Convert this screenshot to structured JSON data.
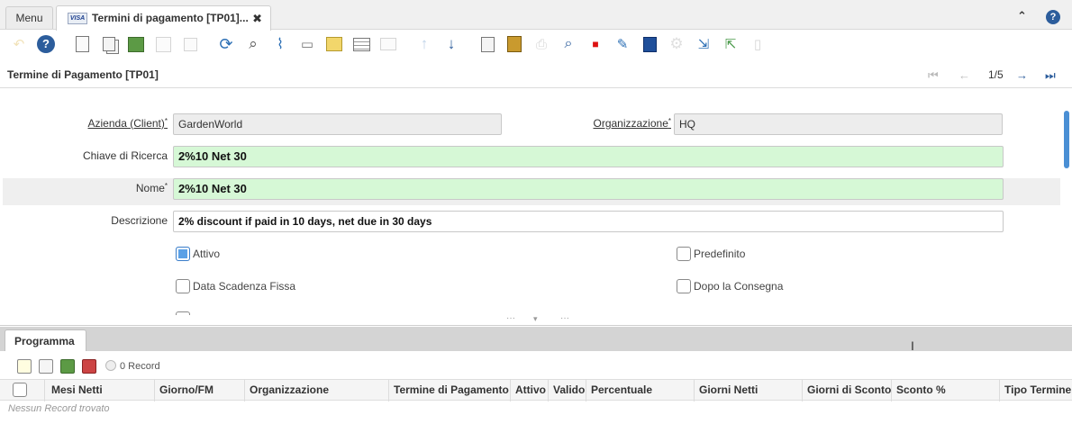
{
  "tabs": {
    "menu": "Menu",
    "window": "Termini di pagamento [TP01]...",
    "close": "✖"
  },
  "header": {
    "title": "Termine di Pagamento [TP01]",
    "page": "1/5"
  },
  "fields": {
    "client_label": "Azienda (Client)",
    "client_value": "GardenWorld",
    "org_label": "Organizzazione",
    "org_value": "HQ",
    "search_key_label": "Chiave di Ricerca",
    "search_key_value": "2%10 Net 30",
    "name_label": "Nome",
    "name_value": "2%10 Net 30",
    "description_label": "Descrizione",
    "description_value": "2% discount if paid in 10 days, net due in 30 days",
    "required_mark": "*"
  },
  "checkboxes": [
    {
      "label": "Attivo",
      "checked": true
    },
    {
      "label": "Predefinito",
      "checked": false
    },
    {
      "label": "Data Scadenza Fissa",
      "checked": false
    },
    {
      "label": "Dopo la Consegna",
      "checked": false
    }
  ],
  "detail": {
    "tab": "Programma",
    "records": "0 Record",
    "columns": [
      "Mesi Netti",
      "Giorno/FM",
      "Organizzazione",
      "Termine di Pagamento",
      "Attivo",
      "Valido",
      "Percentuale",
      "Giorni Netti",
      "Giorni di Sconto",
      "Sconto %",
      "Tipo Termine"
    ],
    "empty": "Nessun Record trovato"
  },
  "colors": {
    "accent": "#2c5d9c",
    "green_field": "#d6f8d6",
    "readonly": "#ededed"
  }
}
